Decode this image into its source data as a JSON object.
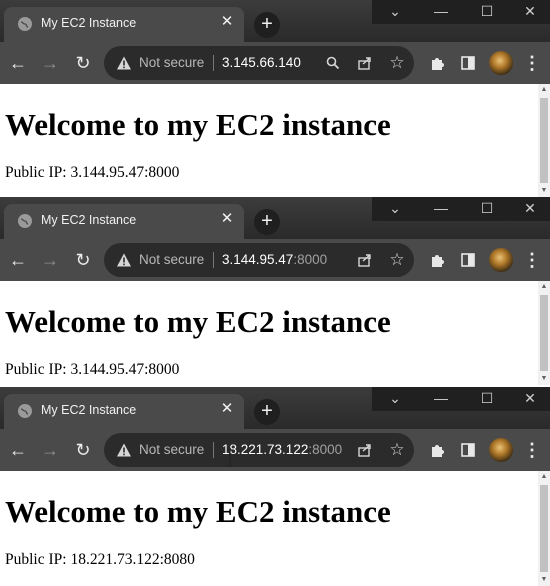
{
  "windows": [
    {
      "tab_title": "My EC2 Instance",
      "security_label": "Not secure",
      "url_host": "3.145.66.140",
      "url_port": "",
      "heading": "Welcome to my EC2 instance",
      "ip_text": "Public IP: 3.144.95.47:8000"
    },
    {
      "tab_title": "My EC2 Instance",
      "security_label": "Not secure",
      "url_host": "3.144.95.47",
      "url_port": ":8000",
      "heading": "Welcome to my EC2 instance",
      "ip_text": "Public IP: 3.144.95.47:8000"
    },
    {
      "tab_title": "My EC2 Instance",
      "security_label": "Not secure",
      "url_host": "18.221.73.122",
      "url_port": ":8000",
      "heading": "Welcome to my EC2 instance",
      "ip_text": "Public IP: 18.221.73.122:8080"
    }
  ],
  "icons": {
    "tab_close": "close-icon",
    "new_tab": "plus-icon",
    "back": "arrow-left-icon",
    "forward": "arrow-right-icon",
    "reload": "reload-icon",
    "warning": "warning-icon",
    "search": "search-icon",
    "share": "share-icon",
    "bookmark": "star-icon",
    "extensions": "puzzle-icon",
    "sidebar": "sidebar-icon",
    "menu": "kebab-menu-icon"
  },
  "colors": {
    "tabstrip": "#2f2f2f",
    "toolbar": "#4a4a4a",
    "omnibox": "#2b2b2b",
    "page_bg": "#ffffff"
  }
}
